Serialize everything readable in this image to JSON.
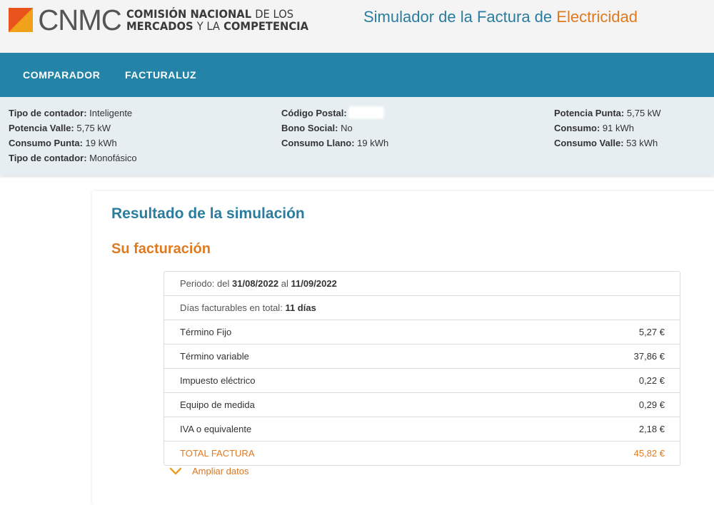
{
  "header": {
    "logo_letters": "CNMC",
    "logo_line1_bold": "COMISIÓN NACIONAL",
    "logo_line1_thin": "DE LOS",
    "logo_line2_a": "MERCADOS",
    "logo_line2_thin": "Y LA",
    "logo_line2_b": "COMPETENCIA",
    "app_title_main": "Simulador de la Factura de",
    "app_title_accent": "Electricidad"
  },
  "nav": {
    "items": [
      {
        "label": "COMPARADOR"
      },
      {
        "label": "FACTURALUZ"
      }
    ]
  },
  "summary": {
    "col1": [
      {
        "label": "Tipo de contador:",
        "value": "Inteligente"
      },
      {
        "label": "Potencia Valle:",
        "value": "5,75 kW"
      },
      {
        "label": "Consumo Punta:",
        "value": "19 kWh"
      },
      {
        "label": "Tipo de contador:",
        "value": "Monofásico"
      }
    ],
    "col2": [
      {
        "label": "Código Postal:",
        "value": ""
      },
      {
        "label": "Bono Social:",
        "value": "No"
      },
      {
        "label": "Consumo Llano:",
        "value": "19 kWh"
      }
    ],
    "col3": [
      {
        "label": "Potencia Punta:",
        "value": "5,75 kW"
      },
      {
        "label": "Consumo:",
        "value": "91 kWh"
      },
      {
        "label": "Consumo Valle:",
        "value": "53 kWh"
      }
    ]
  },
  "result": {
    "title": "Resultado de la simulación",
    "billing_title": "Su facturación",
    "period": {
      "prefix": "Periodo: del",
      "from": "31/08/2022",
      "mid": "al",
      "to": "11/09/2022"
    },
    "days": {
      "prefix": "Días facturables en total:",
      "value": "11 días"
    },
    "lines": [
      {
        "label": "Término Fijo",
        "value": "5,27 €"
      },
      {
        "label": "Término variable",
        "value": "37,86 €"
      },
      {
        "label": "Impuesto eléctrico",
        "value": "0,22 €"
      },
      {
        "label": "Equipo de medida",
        "value": "0,29 €"
      },
      {
        "label": "IVA o equivalente",
        "value": "2,18 €"
      }
    ],
    "total": {
      "label": "TOTAL FACTURA",
      "value": "45,82 €"
    },
    "expand_label": "Ampliar datos"
  },
  "colors": {
    "nav_bg": "#2384a8",
    "title_blue": "#2a7d9e",
    "accent_orange": "#e07a20",
    "summary_bg": "#e6eef2"
  },
  "icons": {
    "expand": "chevron-down-icon"
  }
}
